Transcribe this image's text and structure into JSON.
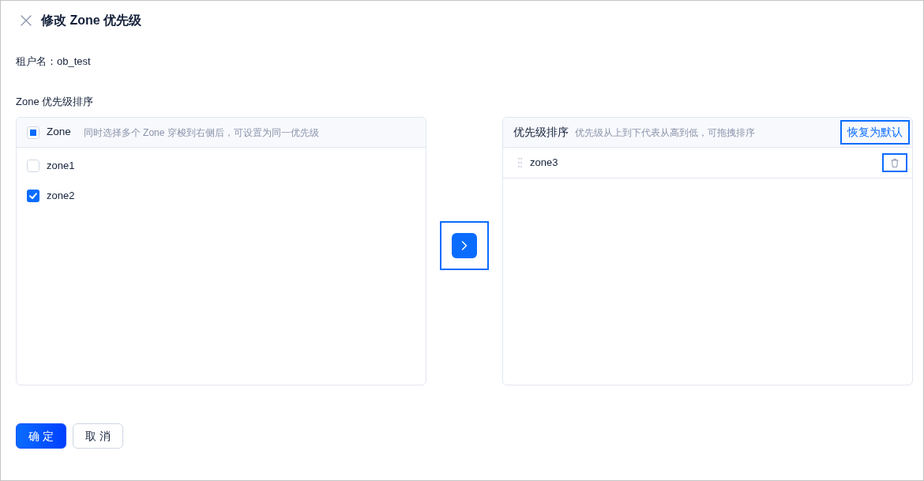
{
  "dialog": {
    "title": "修改 Zone 优先级",
    "tenant": {
      "label": "租户名：",
      "value": "ob_test"
    }
  },
  "section_label": "Zone 优先级排序",
  "source_panel": {
    "header": {
      "label": "Zone",
      "checked": false,
      "indeterminate": true,
      "hint": "同时选择多个 Zone 穿梭到右侧后，可设置为同一优先级"
    },
    "items": [
      {
        "label": "zone1",
        "checked": false
      },
      {
        "label": "zone2",
        "checked": true
      }
    ]
  },
  "transfer_button": {
    "highlighted": true
  },
  "target_panel": {
    "title": "优先级排序",
    "hint": "优先级从上到下代表从高到低，可拖拽排序",
    "reset_button": {
      "label": "恢复为默认",
      "highlighted": true
    },
    "items": [
      {
        "label": "zone3",
        "delete_highlighted": true
      }
    ]
  },
  "footer_buttons": [
    {
      "label": "确 定",
      "kind": "primary"
    },
    {
      "label": "取 消",
      "kind": "default"
    }
  ]
}
